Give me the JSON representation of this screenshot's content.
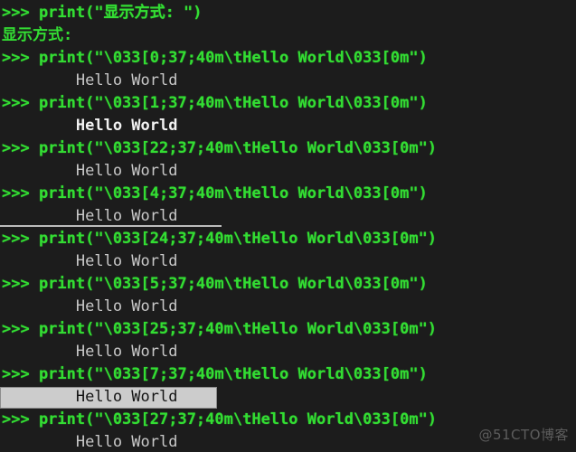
{
  "terminal": {
    "title": "Python interactive shell",
    "colors": {
      "background": "#1c1c1c",
      "prompt_green": "#33dd33",
      "output_gray": "#c8c8c8",
      "bold_white": "#f2f2f2",
      "reverse_background": "#cccccc",
      "reverse_foreground": "#151515",
      "underline_rule": "#bdbdbd",
      "watermark": "#5d5d5d"
    },
    "watermark": "@51CTO博客",
    "lines": [
      {
        "kind": "code",
        "text": ">>> print(\"显示方式: \")"
      },
      {
        "kind": "out-green",
        "text": "显示方式:"
      },
      {
        "kind": "code",
        "text": ">>> print(\"\\033[0;37;40m\\tHello World\\033[0m\")"
      },
      {
        "kind": "out",
        "text": "        Hello World"
      },
      {
        "kind": "code",
        "text": ">>> print(\"\\033[1;37;40m\\tHello World\\033[0m\")"
      },
      {
        "kind": "bold",
        "text": "        Hello World"
      },
      {
        "kind": "code",
        "text": ">>> print(\"\\033[22;37;40m\\tHello World\\033[0m\")"
      },
      {
        "kind": "out",
        "text": "        Hello World"
      },
      {
        "kind": "code",
        "text": ">>> print(\"\\033[4;37;40m\\tHello World\\033[0m\")"
      },
      {
        "kind": "underline",
        "text": "        Hello World"
      },
      {
        "kind": "code",
        "text": ">>> print(\"\\033[24;37;40m\\tHello World\\033[0m\")"
      },
      {
        "kind": "out",
        "text": "        Hello World"
      },
      {
        "kind": "code",
        "text": ">>> print(\"\\033[5;37;40m\\tHello World\\033[0m\")"
      },
      {
        "kind": "out",
        "text": "        Hello World"
      },
      {
        "kind": "code",
        "text": ">>> print(\"\\033[25;37;40m\\tHello World\\033[0m\")"
      },
      {
        "kind": "out",
        "text": "        Hello World"
      },
      {
        "kind": "code",
        "text": ">>> print(\"\\033[7;37;40m\\tHello World\\033[0m\")"
      },
      {
        "kind": "reverse",
        "text": "        Hello World"
      },
      {
        "kind": "code",
        "text": ">>> print(\"\\033[27;37;40m\\tHello World\\033[0m\")"
      },
      {
        "kind": "out",
        "text": "        Hello World"
      }
    ]
  }
}
